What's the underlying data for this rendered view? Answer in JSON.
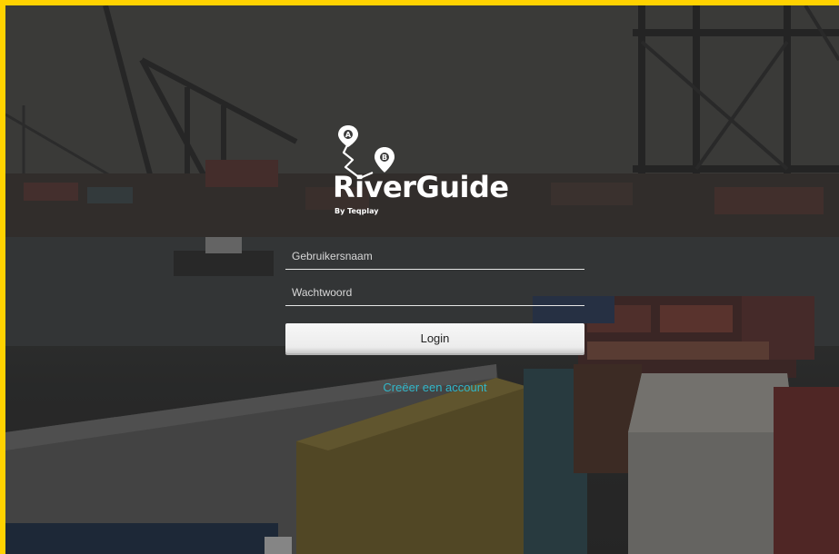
{
  "app": {
    "name": "RiverGuide",
    "byline": "By Teqplay"
  },
  "login_form": {
    "username_placeholder": "Gebruikersnaam",
    "password_placeholder": "Wachtwoord",
    "login_label": "Login",
    "create_account_label": "Creëer een account"
  },
  "logo_mark": {
    "pin_a_letter": "A",
    "pin_b_letter": "B"
  },
  "colors": {
    "frame_border": "#ffd200",
    "link": "#31b6c8",
    "button_bg": "#ececec"
  }
}
